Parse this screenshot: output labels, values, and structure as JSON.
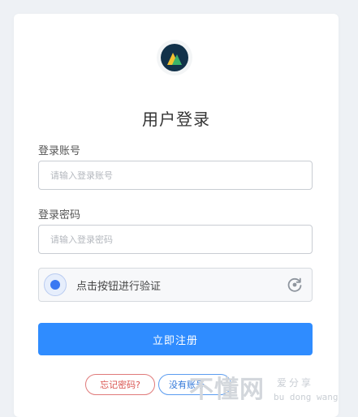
{
  "app": {
    "title": "用户登录",
    "logo_icon": "mountain-logo-icon"
  },
  "form": {
    "account": {
      "label": "登录账号",
      "value": "",
      "placeholder": "请输入登录账号"
    },
    "password": {
      "label": "登录密码",
      "value": "",
      "placeholder": "请输入登录密码"
    },
    "captcha": {
      "text": "点击按钮进行验证",
      "icon": "refresh-icon"
    },
    "submit_label": "立即注册"
  },
  "links": {
    "forgot": "忘记密码?",
    "register": "没有账号"
  },
  "watermark": {
    "main": "不懂网",
    "sub1": "爱分享",
    "sub2": "bu dong wang"
  },
  "colors": {
    "primary": "#2f8cff",
    "forgot": "#d9534f",
    "background": "#eef1f5"
  }
}
